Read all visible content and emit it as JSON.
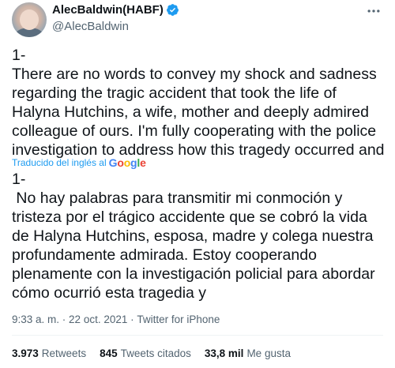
{
  "author": {
    "display_name": "AlecBaldwin(HABF)",
    "handle": "@AlecBaldwin",
    "verified": true
  },
  "tweet": {
    "text": "1-\nThere are no words to convey my shock and sadness regarding the tragic accident that took the life of Halyna Hutchins, a wife, mother and deeply admired colleague of ours. I'm fully cooperating with the police investigation to address how this tragedy occurred and",
    "translated_label": "Traducido del inglés al",
    "translator": "Google",
    "translation": "1-\n No hay palabras para transmitir mi conmoción y tristeza por el trágico accidente que se cobró la vida de Halyna Hutchins, esposa, madre y colega nuestra profundamente admirada. Estoy cooperando plenamente con la investigación policial para abordar cómo ocurrió esta tragedia y"
  },
  "meta": {
    "time": "9:33 a. m.",
    "separator": " · ",
    "date": "22 oct. 2021",
    "source": "Twitter for iPhone"
  },
  "stats": {
    "retweets_count": "3.973",
    "retweets_label": "Retweets",
    "quotes_count": "845",
    "quotes_label": "Tweets citados",
    "likes_count": "33,8 mil",
    "likes_label": "Me gusta"
  },
  "colors": {
    "link_blue": "#1d9bf0",
    "text": "#0f1419",
    "secondary": "#536471"
  },
  "icons": {
    "verified": "verified-badge-icon",
    "more": "more-options-icon"
  }
}
